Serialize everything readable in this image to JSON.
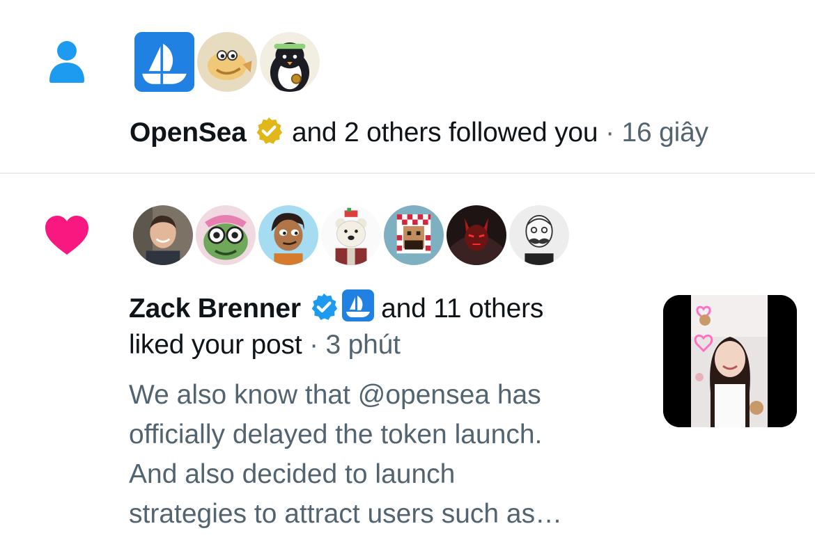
{
  "follow_notification": {
    "icon": "person-icon",
    "icon_color": "#1d9bf0",
    "avatars": [
      "opensea-logo",
      "cartoon-fish-avatar",
      "penguin-avatar"
    ],
    "name": "OpenSea",
    "verified_badge": "gold-verified-badge",
    "action_text": "and 2 others followed you",
    "separator": "·",
    "time": "16 giây"
  },
  "like_notification": {
    "icon": "heart-icon",
    "icon_color": "#f91880",
    "avatars": [
      "man-photo-avatar",
      "frog-nft-avatar",
      "cartoon-man-avatar",
      "polar-bear-avatar",
      "pixel-arab-avatar",
      "red-demon-avatar",
      "sketch-man-avatar"
    ],
    "name": "Zack Brenner",
    "verified_badge": "blue-verified-badge",
    "affiliate_badge": "opensea-affiliate-badge",
    "action_line1": "and 11 others",
    "action_line2": "liked your post",
    "separator": "·",
    "time": "3 phút",
    "post_preview_lines": [
      "We also know that @opensea has",
      "officially delayed the token launch.",
      "And also decided to launch",
      "strategies to attract users such as…"
    ],
    "thumbnail": "post-media-thumbnail"
  },
  "colors": {
    "text_primary": "#0f1419",
    "text_secondary": "#536471",
    "divider": "#e7e9ec",
    "verified_blue": "#1d9bf0",
    "verified_gold": "#e2b719",
    "opensea_blue": "#2081e2"
  }
}
